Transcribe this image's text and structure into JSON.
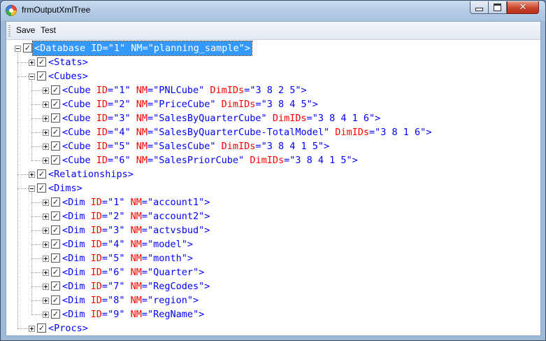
{
  "window": {
    "title": "frmOutputXmlTree",
    "close_glyph": "✕"
  },
  "menu": {
    "items": [
      "Save",
      "Test"
    ]
  },
  "tree": {
    "rows": [
      {
        "level": 0,
        "expander": "minus",
        "checked": true,
        "selected": true,
        "tag": "<Database",
        "attrs": [
          [
            "ID",
            "\"1\""
          ],
          [
            "NM",
            "\"planning_sample\""
          ]
        ],
        "close": ">"
      },
      {
        "level": 1,
        "expander": "plus",
        "checked": true,
        "tag": "<Stats>",
        "attrs": [],
        "close": ""
      },
      {
        "level": 1,
        "expander": "minus",
        "checked": true,
        "tag": "<Cubes>",
        "attrs": [],
        "close": ""
      },
      {
        "level": 2,
        "expander": "plus",
        "checked": true,
        "tag": "<Cube",
        "attrs": [
          [
            "ID",
            "\"1\""
          ],
          [
            "NM",
            "\"PNLCube\""
          ],
          [
            "DimIDs",
            "\"3 8 2 5\""
          ]
        ],
        "close": ">"
      },
      {
        "level": 2,
        "expander": "plus",
        "checked": true,
        "tag": "<Cube",
        "attrs": [
          [
            "ID",
            "\"2\""
          ],
          [
            "NM",
            "\"PriceCube\""
          ],
          [
            "DimIDs",
            "\"3 8 4 5\""
          ]
        ],
        "close": ">"
      },
      {
        "level": 2,
        "expander": "plus",
        "checked": true,
        "tag": "<Cube",
        "attrs": [
          [
            "ID",
            "\"3\""
          ],
          [
            "NM",
            "\"SalesByQuarterCube\""
          ],
          [
            "DimIDs",
            "\"3 8 4 1 6\""
          ]
        ],
        "close": ">"
      },
      {
        "level": 2,
        "expander": "plus",
        "checked": true,
        "tag": "<Cube",
        "attrs": [
          [
            "ID",
            "\"4\""
          ],
          [
            "NM",
            "\"SalesByQuarterCube-TotalModel\""
          ],
          [
            "DimIDs",
            "\"3 8 1 6\""
          ]
        ],
        "close": ">"
      },
      {
        "level": 2,
        "expander": "plus",
        "checked": true,
        "tag": "<Cube",
        "attrs": [
          [
            "ID",
            "\"5\""
          ],
          [
            "NM",
            "\"SalesCube\""
          ],
          [
            "DimIDs",
            "\"3 8 4 1 5\""
          ]
        ],
        "close": ">"
      },
      {
        "level": 2,
        "expander": "plus",
        "checked": true,
        "tag": "<Cube",
        "attrs": [
          [
            "ID",
            "\"6\""
          ],
          [
            "NM",
            "\"SalesPriorCube\""
          ],
          [
            "DimIDs",
            "\"3 8 4 1 5\""
          ]
        ],
        "close": ">"
      },
      {
        "level": 1,
        "expander": "plus",
        "checked": true,
        "tag": "<Relationships>",
        "attrs": [],
        "close": ""
      },
      {
        "level": 1,
        "expander": "minus",
        "checked": true,
        "tag": "<Dims>",
        "attrs": [],
        "close": ""
      },
      {
        "level": 2,
        "expander": "plus",
        "checked": true,
        "tag": "<Dim",
        "attrs": [
          [
            "ID",
            "\"1\""
          ],
          [
            "NM",
            "\"account1\""
          ]
        ],
        "close": ">"
      },
      {
        "level": 2,
        "expander": "plus",
        "checked": true,
        "tag": "<Dim",
        "attrs": [
          [
            "ID",
            "\"2\""
          ],
          [
            "NM",
            "\"account2\""
          ]
        ],
        "close": ">"
      },
      {
        "level": 2,
        "expander": "plus",
        "checked": true,
        "tag": "<Dim",
        "attrs": [
          [
            "ID",
            "\"3\""
          ],
          [
            "NM",
            "\"actvsbud\""
          ]
        ],
        "close": ">"
      },
      {
        "level": 2,
        "expander": "plus",
        "checked": true,
        "tag": "<Dim",
        "attrs": [
          [
            "ID",
            "\"4\""
          ],
          [
            "NM",
            "\"model\""
          ]
        ],
        "close": ">"
      },
      {
        "level": 2,
        "expander": "plus",
        "checked": true,
        "tag": "<Dim",
        "attrs": [
          [
            "ID",
            "\"5\""
          ],
          [
            "NM",
            "\"month\""
          ]
        ],
        "close": ">"
      },
      {
        "level": 2,
        "expander": "plus",
        "checked": true,
        "tag": "<Dim",
        "attrs": [
          [
            "ID",
            "\"6\""
          ],
          [
            "NM",
            "\"Quarter\""
          ]
        ],
        "close": ">"
      },
      {
        "level": 2,
        "expander": "plus",
        "checked": true,
        "tag": "<Dim",
        "attrs": [
          [
            "ID",
            "\"7\""
          ],
          [
            "NM",
            "\"RegCodes\""
          ]
        ],
        "close": ">"
      },
      {
        "level": 2,
        "expander": "plus",
        "checked": true,
        "tag": "<Dim",
        "attrs": [
          [
            "ID",
            "\"8\""
          ],
          [
            "NM",
            "\"region\""
          ]
        ],
        "close": ">"
      },
      {
        "level": 2,
        "expander": "plus",
        "checked": true,
        "tag": "<Dim",
        "attrs": [
          [
            "ID",
            "\"9\""
          ],
          [
            "NM",
            "\"RegName\""
          ]
        ],
        "close": ">"
      },
      {
        "level": 1,
        "expander": "plus",
        "checked": true,
        "tag": "<Procs>",
        "attrs": [],
        "close": ""
      }
    ]
  }
}
